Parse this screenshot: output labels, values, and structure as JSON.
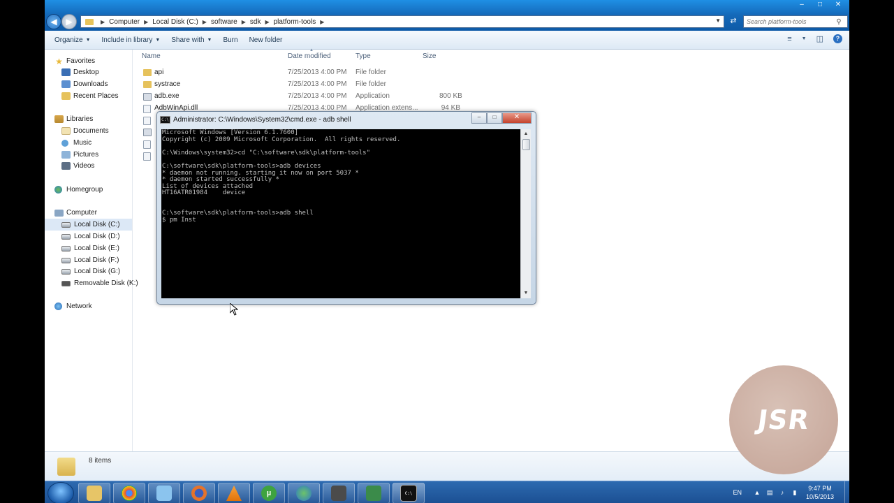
{
  "explorer": {
    "breadcrumb": [
      "Computer",
      "Local Disk (C:)",
      "software",
      "sdk",
      "platform-tools"
    ],
    "search_placeholder": "Search platform-tools",
    "toolbar": {
      "organize": "Organize",
      "include_in_library": "Include in library",
      "share_with": "Share with",
      "burn": "Burn",
      "new_folder": "New folder"
    },
    "nav": {
      "favorites": "Favorites",
      "desktop": "Desktop",
      "downloads": "Downloads",
      "recent_places": "Recent Places",
      "libraries": "Libraries",
      "documents": "Documents",
      "music": "Music",
      "pictures": "Pictures",
      "videos": "Videos",
      "homegroup": "Homegroup",
      "computer": "Computer",
      "drive_c": "Local Disk (C:)",
      "drive_d": "Local Disk (D:)",
      "drive_e": "Local Disk (E:)",
      "drive_f": "Local Disk (F:)",
      "drive_g": "Local Disk (G:)",
      "drive_k": "Removable Disk (K:)",
      "network": "Network"
    },
    "columns": {
      "name": "Name",
      "date": "Date modified",
      "type": "Type",
      "size": "Size"
    },
    "files": [
      {
        "name": "api",
        "date": "7/25/2013 4:00 PM",
        "type": "File folder",
        "size": "",
        "icon": "folder-icon"
      },
      {
        "name": "systrace",
        "date": "7/25/2013 4:00 PM",
        "type": "File folder",
        "size": "",
        "icon": "folder-icon"
      },
      {
        "name": "adb.exe",
        "date": "7/25/2013 4:00 PM",
        "type": "Application",
        "size": "800 KB",
        "icon": "application-icon"
      },
      {
        "name": "AdbWinApi.dll",
        "date": "7/25/2013 4:00 PM",
        "type": "Application extens...",
        "size": "94 KB",
        "icon": "dll-file-icon"
      }
    ],
    "status": "8 items"
  },
  "cmd": {
    "title": "Administrator: C:\\Windows\\System32\\cmd.exe - adb  shell",
    "lines": [
      "Microsoft Windows [Version 6.1.7600]",
      "Copyright (c) 2009 Microsoft Corporation.  All rights reserved.",
      "",
      "C:\\Windows\\system32>cd \"C:\\software\\sdk\\platform-tools\"",
      "",
      "C:\\software\\sdk\\platform-tools>adb devices",
      "* daemon not running. starting it now on port 5037 *",
      "* daemon started successfully *",
      "List of devices attached",
      "HT16ATR01984    device",
      "",
      "",
      "C:\\software\\sdk\\platform-tools>adb shell",
      "$ pm Inst"
    ]
  },
  "watermark": "JSR",
  "taskbar": {
    "apps": [
      "file-explorer-icon",
      "chrome-icon",
      "notepad-icon",
      "firefox-icon",
      "vlc-icon",
      "utorrent-icon",
      "globe-icon",
      "app-icon",
      "terminal-icon",
      "cmd-icon"
    ],
    "language": "EN",
    "time": "9:47 PM",
    "date": "10/5/2013"
  },
  "colors": {
    "titlebar": "#1468b8",
    "console_bg": "#000000",
    "console_text": "#c0c0c0",
    "taskbar": "#1b4f92",
    "selected_nav": "#dce8f6"
  }
}
